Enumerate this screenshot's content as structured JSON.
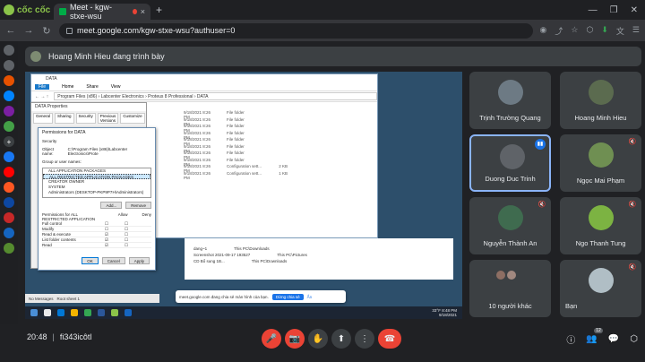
{
  "browser": {
    "logo_label": "cốc cốc",
    "tab_title": "Meet - kgw-stxe-wsu",
    "tab_close": "×",
    "new_tab": "+",
    "win_minimize": "—",
    "win_restore": "❐",
    "win_close": "✕",
    "url": "meet.google.com/kgw-stxe-wsu?authuser=0",
    "nav_back": "←",
    "nav_forward": "→",
    "nav_reload": "↻"
  },
  "banner": {
    "presenter_text": "Hoang Minh Hieu đang trình bày"
  },
  "shared_screen": {
    "explorer_title": "DATA",
    "ribbon_tabs": [
      "File",
      "Home",
      "Share",
      "View"
    ],
    "path_text": "Program Files (x86) › Labcenter Electronics › Proteus 8 Professional › DATA",
    "files": [
      {
        "date": "9/18/2021 8:26 PM",
        "type": "File folder",
        "size": ""
      },
      {
        "date": "9/18/2021 8:26 PM",
        "type": "File folder",
        "size": ""
      },
      {
        "date": "9/18/2021 8:26 PM",
        "type": "File folder",
        "size": ""
      },
      {
        "date": "9/18/2021 8:26 PM",
        "type": "File folder",
        "size": ""
      },
      {
        "date": "9/18/2021 8:26 PM",
        "type": "File folder",
        "size": ""
      },
      {
        "date": "9/18/2021 8:26 PM",
        "type": "File folder",
        "size": ""
      },
      {
        "date": "9/18/2021 8:26 PM",
        "type": "File folder",
        "size": ""
      },
      {
        "date": "9/18/2021 8:26 PM",
        "type": "File folder",
        "size": ""
      },
      {
        "date": "9/18/2021 8:26 PM",
        "type": "Configuration sett...",
        "size": "2 KB"
      },
      {
        "date": "9/18/2021 8:26 PM",
        "type": "Configuration sett...",
        "size": "1 KB"
      }
    ],
    "props_title": "DATA Properties",
    "props_tabs": [
      "General",
      "Sharing",
      "Security",
      "Previous Versions",
      "Customize"
    ],
    "perm_title": "Permissions for DATA",
    "security_label": "Security",
    "object_name_label": "Object name:",
    "object_name_value": "C:\\Program Files (x86)\\Labcenter Electronics\\Prote",
    "group_label": "Group or user names:",
    "groups": [
      "ALL APPLICATION PACKAGES",
      "ALL RESTRICTED APPLICATION PACKAGES",
      "CREATOR OWNER",
      "SYSTEM",
      "Administrators (DESKTOP-PKP9P7H\\Administrators)"
    ],
    "add_button": "Add...",
    "remove_button": "Remove",
    "perm_for_label": "Permissions for ALL RESTRICTED APPLICATION",
    "allow_label": "Allow",
    "deny_label": "Deny",
    "permissions": [
      "Full control",
      "Modify",
      "Read & execute",
      "List folder contents",
      "Read"
    ],
    "ok_button": "OK",
    "cancel_button": "Cancel",
    "apply_button": "Apply",
    "lower_files": [
      {
        "name": "dang~1",
        "loc": "This PC\\Downloads"
      },
      {
        "name": "Screenshot 2021-09-17 193527",
        "loc": "This PC\\Pictures"
      },
      {
        "name": "CD Bổ sung 1B...",
        "loc": "This PC\\Downloads"
      }
    ],
    "proteus_status": "No Messages",
    "proteus_sheet": "Root sheet 1",
    "share_notice_text": "meet.google.com đang chia sẻ màn hình của bạn.",
    "stop_share_button": "Dừng chia sẻ",
    "hide_button": "Ẩn",
    "tray_time": "8:48 PM",
    "tray_date": "9/18/2021",
    "tray_weather": "33°F"
  },
  "participants": [
    {
      "name": "Trịnh Trường Quang",
      "color": "#6d7a84"
    },
    {
      "name": "Hoang Minh Hieu",
      "color": "#5b6b4f"
    },
    {
      "name": "Duong Duc Trinh",
      "color": "#5f6368",
      "active": true
    },
    {
      "name": "Ngọc Mai Phạm",
      "color": "#6f8f52"
    },
    {
      "name": "Nguyễn Thành An",
      "color": "#3f6b4f"
    },
    {
      "name": "Ngo Thanh Tung",
      "color": "#7cb342"
    },
    {
      "name": "10 người khác",
      "color": "#8d6e63"
    },
    {
      "name": "Bạn",
      "color": "#b0bec5"
    }
  ],
  "meeting": {
    "time": "20:48",
    "separator": "|",
    "code": "fi343icôtl",
    "participant_count": "12"
  },
  "icons": {
    "mic_off": "🎤",
    "cam_off": "📷",
    "raise_hand": "✋",
    "present": "⬆",
    "more": "⋮",
    "end_call": "☎",
    "info": "ⓘ",
    "people": "👥",
    "chat": "💬",
    "activities": "⬡",
    "mute": "🔇",
    "speaking": "▮▮"
  },
  "colors": {
    "accent": "#1a73e8",
    "danger": "#ea4335",
    "tile_bg": "#3c4043",
    "active_border": "#8ab4f8"
  }
}
